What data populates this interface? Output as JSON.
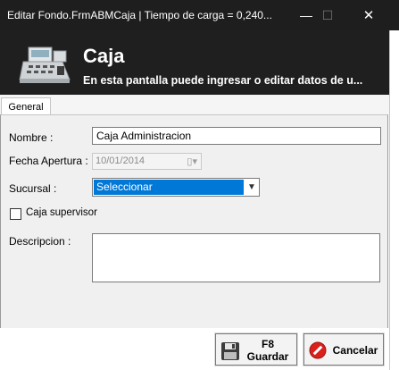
{
  "window": {
    "title": "Editar Fondo.FrmABMCaja | Tiempo de carga = 0,240...",
    "minimize_glyph": "—",
    "maximize_glyph": "☐",
    "close_glyph": "✕"
  },
  "banner": {
    "heading": "Caja",
    "subtitle": "En esta pantalla puede ingresar o editar datos de u...",
    "icon": "cash-register-icon"
  },
  "tabs": [
    {
      "label": "General",
      "selected": true
    }
  ],
  "form": {
    "nombre_label": "Nombre :",
    "nombre_value": "Caja Administracion",
    "fecha_label": "Fecha Apertura :",
    "fecha_value": "10/01/2014",
    "sucursal_label": "Sucursal :",
    "sucursal_value": "Seleccionar",
    "caja_supervisor_label": "Caja supervisor",
    "caja_supervisor_checked": false,
    "descripcion_label": "Descripcion :",
    "descripcion_value": ""
  },
  "buttons": {
    "guardar_key": "F8",
    "guardar_label": "Guardar",
    "cancelar_label": "Cancelar"
  },
  "colors": {
    "titlebar": "#1e1e1e",
    "banner": "#1f1f1f",
    "selection": "#0078d7",
    "cancel_icon": "#d9201c"
  }
}
